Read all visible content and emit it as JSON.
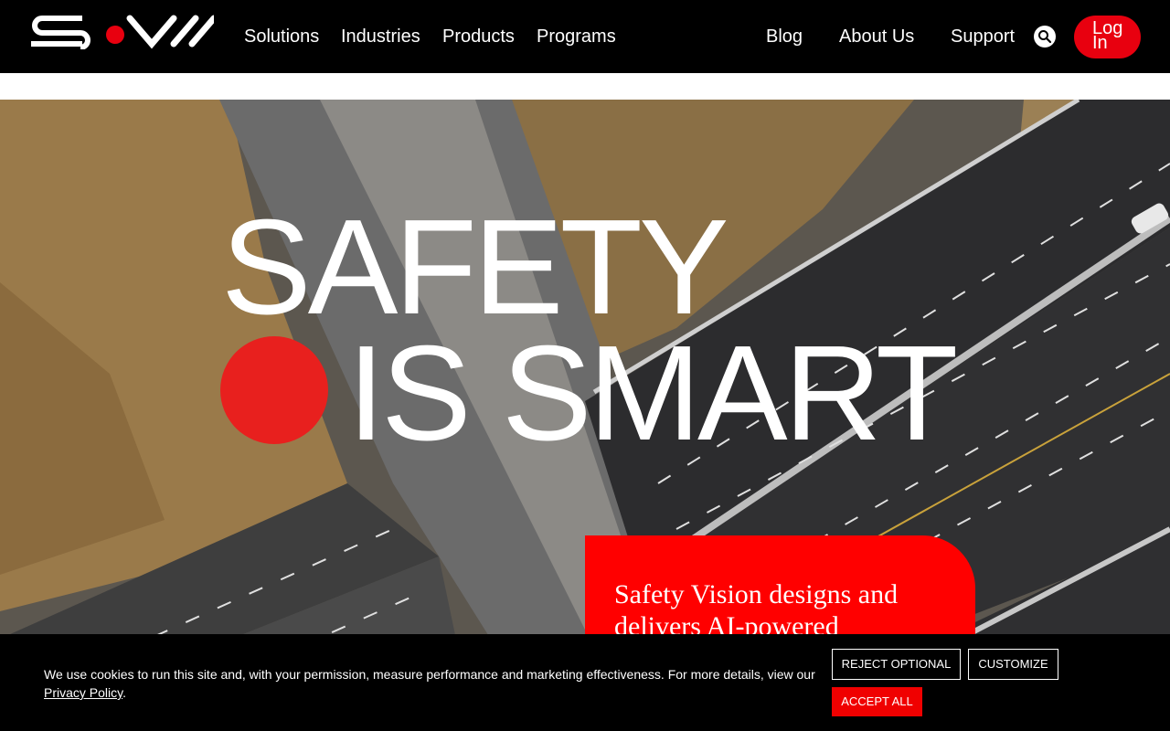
{
  "header": {
    "logo_label": "SVII",
    "nav_left": [
      "Solutions",
      "Industries",
      "Products",
      "Programs"
    ],
    "nav_right": [
      "Blog",
      "About Us",
      "Support"
    ],
    "login_label": "Log In",
    "search_icon": "search-icon"
  },
  "hero": {
    "headline_line1": "SAFETY",
    "headline_line2": "IS SMART",
    "promo_text": "Safety Vision designs and delivers AI-powered"
  },
  "cookie_banner": {
    "text": "We use cookies to run this site and, with your permission, measure performance and marketing effectiveness. For more details, view our",
    "link_text": "Privacy Policy",
    "after_link": ".",
    "reject_label": "REJECT OPTIONAL",
    "customize_label": "CUSTOMIZE",
    "accept_label": "ACCEPT ALL"
  },
  "colors": {
    "brand_red": "#e8000f",
    "header_bg": "#000000",
    "accent_dot": "#e8201e"
  }
}
